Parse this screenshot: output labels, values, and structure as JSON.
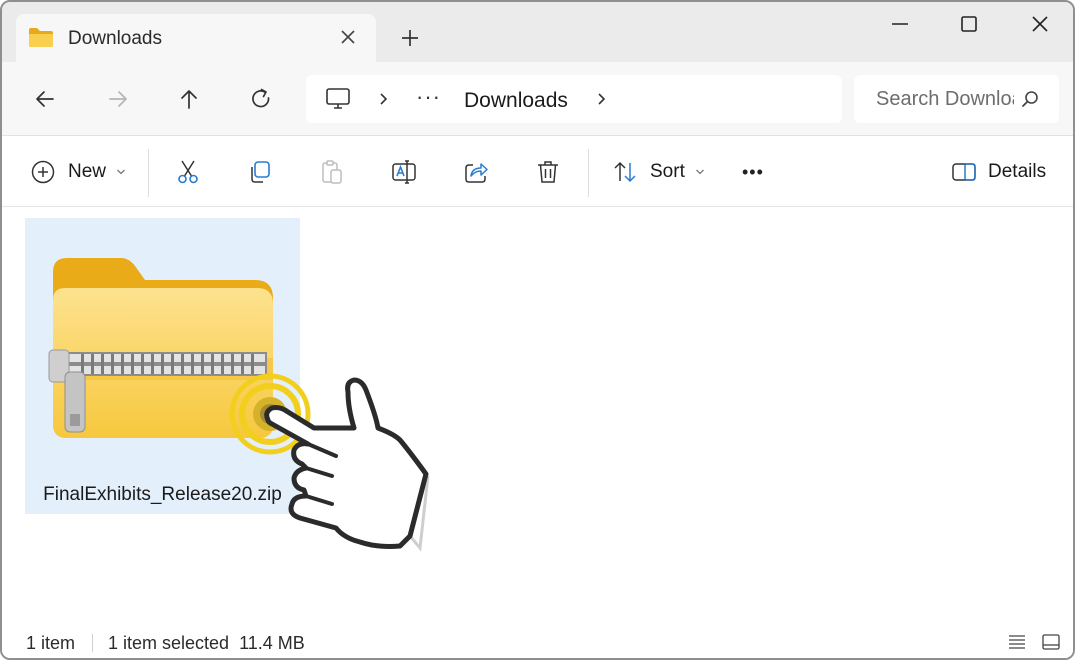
{
  "window": {
    "tab_title": "Downloads",
    "controls": [
      "minimize-icon",
      "maximize-icon",
      "close-icon"
    ]
  },
  "navigation": {
    "buttons": [
      "back-arrow-icon",
      "forward-arrow-icon",
      "up-arrow-icon",
      "refresh-icon"
    ],
    "breadcrumb_overflow": "···",
    "breadcrumb_current": "Downloads",
    "search_placeholder": "Search Downloads"
  },
  "commandbar": {
    "new_label": "New",
    "sort_label": "Sort",
    "details_label": "Details",
    "more_label": "•••",
    "actions": [
      "cut-icon",
      "copy-icon",
      "paste-icon",
      "rename-icon",
      "share-icon",
      "delete-icon"
    ]
  },
  "files": [
    {
      "name": "FinalExhibits_Release20.zip",
      "type": "compressed-folder",
      "selected": true
    }
  ],
  "statusbar": {
    "item_count": "1 item",
    "selection": "1 item selected  11.4 MB"
  },
  "colors": {
    "selection_bg": "#e3effb",
    "folder_yellow": "#f7c948",
    "tap_ring": "#f2cf1d"
  }
}
